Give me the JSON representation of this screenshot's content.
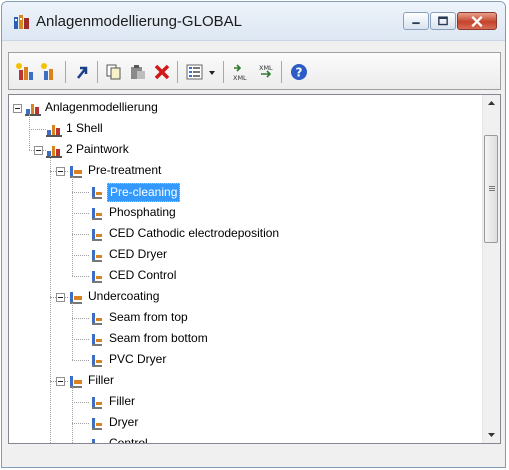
{
  "window": {
    "title": "Anlagenmodellierung-GLOBAL"
  },
  "toolbar": {
    "buttons": [
      "new-node-icon",
      "new-subnode-icon",
      "jump-arrow-icon",
      "copy-icon",
      "paste-icon",
      "delete-icon",
      "list-view-icon",
      "export-xml-icon",
      "import-xml-icon",
      "help-icon"
    ]
  },
  "tree": {
    "root": "Anlagenmodellierung",
    "shell": "1 Shell",
    "paintwork": "2 Paintwork",
    "pretreatment": "Pre-treatment",
    "pre_items": [
      "Pre-cleaning",
      "Phosphating",
      "CED Cathodic electrodeposition",
      "CED Dryer",
      "CED Control"
    ],
    "undercoating": "Undercoating",
    "under_items": [
      "Seam from top",
      "Seam from bottom",
      "PVC Dryer"
    ],
    "filler": "Filler",
    "filler_items": [
      "Filler",
      "Dryer",
      "Control"
    ],
    "selected": "Pre-cleaning"
  },
  "colors": {
    "selection": "#3399ff",
    "close": "#c4442d"
  }
}
